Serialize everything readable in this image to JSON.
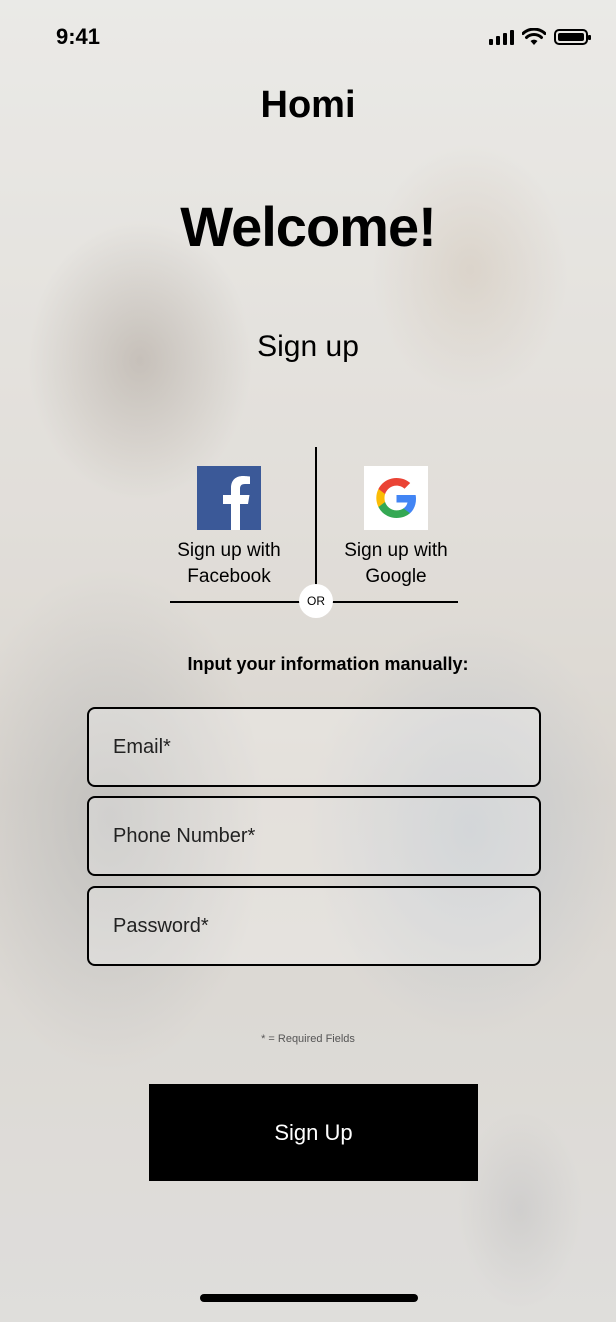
{
  "status_bar": {
    "time": "9:41",
    "icons": [
      "cellular-signal-icon",
      "wifi-icon",
      "battery-icon"
    ]
  },
  "app": {
    "name": "Homi"
  },
  "header": {
    "welcome": "Welcome!",
    "subtitle": "Sign up"
  },
  "social": {
    "facebook": {
      "icon": "facebook-icon",
      "label_line1": "Sign up with",
      "label_line2": "Facebook",
      "color": "#3b5998"
    },
    "google": {
      "icon": "google-icon",
      "label_line1": "Sign up with",
      "label_line2": "Google",
      "colors": [
        "#4285F4",
        "#EA4335",
        "#FBBC05",
        "#34A853"
      ]
    },
    "divider_label": "OR"
  },
  "form": {
    "manual_label": "Input your information manually:",
    "email": {
      "placeholder": "Email*",
      "value": ""
    },
    "phone": {
      "placeholder": "Phone Number*",
      "value": ""
    },
    "password": {
      "placeholder": "Password*",
      "value": ""
    },
    "required_note": "* = Required Fields"
  },
  "actions": {
    "signup_label": "Sign Up"
  },
  "colors": {
    "primary_button": "#000000",
    "primary_button_text": "#ffffff",
    "text": "#000000"
  }
}
